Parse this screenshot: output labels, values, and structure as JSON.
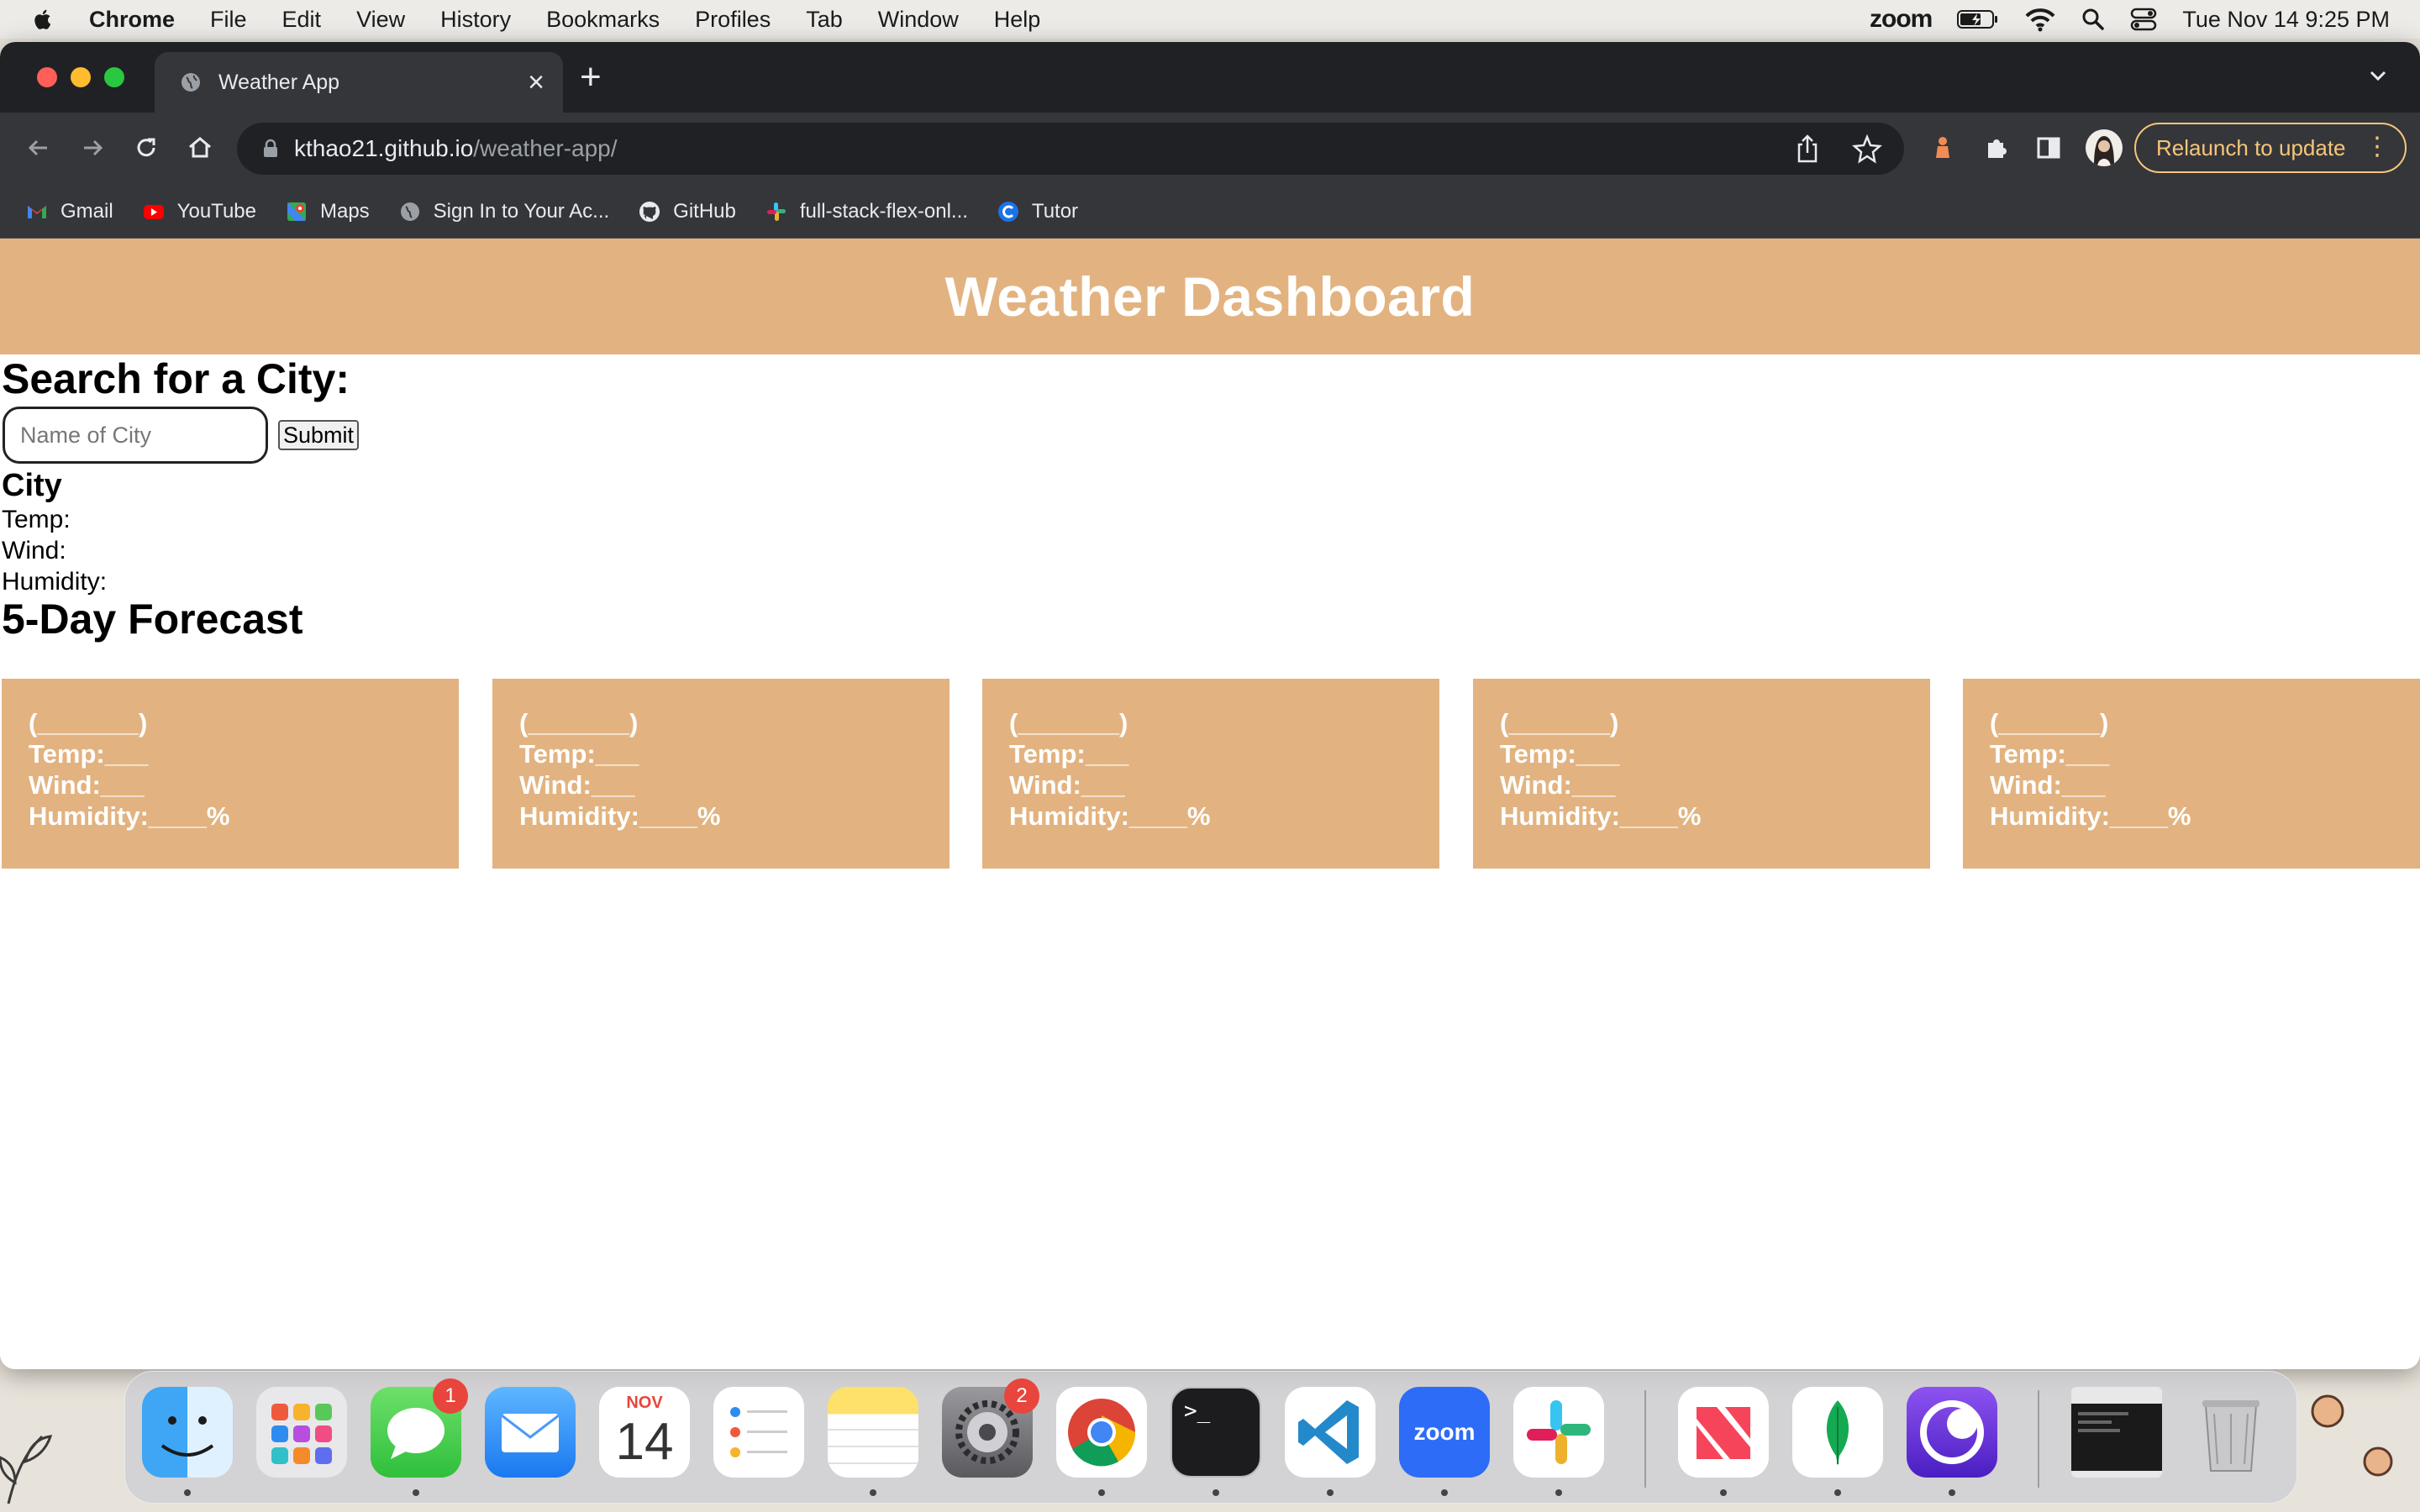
{
  "menubar": {
    "app_name": "Chrome",
    "items": [
      "File",
      "Edit",
      "View",
      "History",
      "Bookmarks",
      "Profiles",
      "Tab",
      "Window",
      "Help"
    ],
    "zoom_label": "zoom",
    "clock": "Tue Nov 14  9:25 PM"
  },
  "browser": {
    "tab_title": "Weather App",
    "url_host": "kthao21.github.io",
    "url_path": "/weather-app/",
    "relaunch_label": "Relaunch to update",
    "bookmarks": [
      "Gmail",
      "YouTube",
      "Maps",
      "Sign In to Your Ac...",
      "GitHub",
      "full-stack-flex-onl...",
      "Tutor"
    ]
  },
  "page": {
    "header_title": "Weather Dashboard",
    "search_title": "Search for a City:",
    "search_placeholder": "Name of City",
    "submit_label": "Submit",
    "city_label": "City",
    "temp_label": "Temp:",
    "wind_label": "Wind:",
    "humidity_label": "Humidity:",
    "forecast_title": "5-Day Forecast",
    "forecast_cards": [
      {
        "date": "(_______)",
        "temp": "Temp:___",
        "wind": "Wind:___",
        "humidity": "Humidity:____%"
      },
      {
        "date": "(_______)",
        "temp": "Temp:___",
        "wind": "Wind:___",
        "humidity": "Humidity:____%"
      },
      {
        "date": "(_______)",
        "temp": "Temp:___",
        "wind": "Wind:___",
        "humidity": "Humidity:____%"
      },
      {
        "date": "(_______)",
        "temp": "Temp:___",
        "wind": "Wind:___",
        "humidity": "Humidity:____%"
      },
      {
        "date": "(_______)",
        "temp": "Temp:___",
        "wind": "Wind:___",
        "humidity": "Humidity:____%"
      }
    ]
  },
  "dock": {
    "apps": [
      "finder-icon",
      "launchpad-icon",
      "messages-icon",
      "mail-icon",
      "calendar-icon",
      "reminders-icon",
      "notes-icon",
      "system-settings-icon",
      "chrome-icon",
      "terminal-icon",
      "vscode-icon",
      "zoom-icon",
      "slack-icon",
      "news-icon",
      "mongodb-icon",
      "app-icon",
      "screenshot-icon",
      "trash-icon"
    ],
    "messages_badge": "1",
    "settings_badge": "2",
    "calendar_month": "NOV",
    "calendar_day": "14",
    "zoom_label": "zoom"
  },
  "colors": {
    "accent": "#e2b380",
    "chrome_dark": "#202124",
    "chrome_toolbar": "#35363a",
    "relaunch": "#f6c679"
  }
}
